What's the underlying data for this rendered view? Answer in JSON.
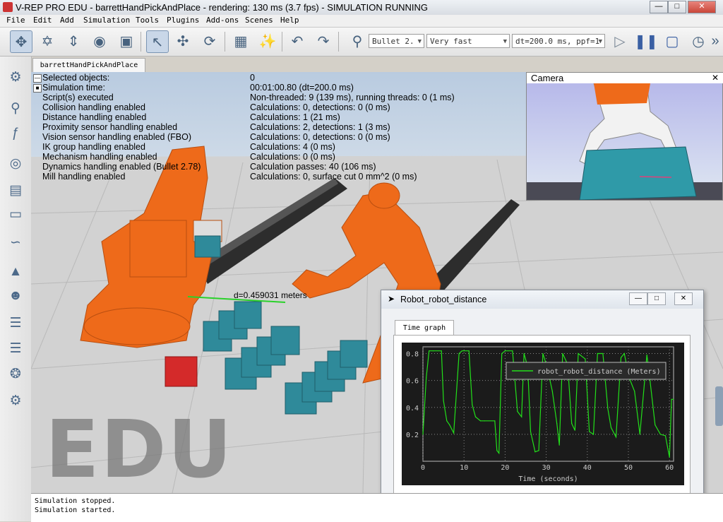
{
  "window": {
    "title": "V-REP PRO EDU - barrettHandPickAndPlace - rendering: 130 ms (3.7 fps) - SIMULATION RUNNING",
    "min": "—",
    "max": "□",
    "close": "✕"
  },
  "menu": [
    "File",
    "Edit",
    "Add",
    "Simulation",
    "Tools",
    "Plugins",
    "Add-ons",
    "Scenes",
    "Help"
  ],
  "toolbar": {
    "engine": "Bullet 2.",
    "speed": "Very fast",
    "timestep": "dt=200.0 ms, ppf=1"
  },
  "scene_tab": "barrettHandPickAndPlace",
  "info": {
    "labels": [
      "Selected objects:",
      "Simulation time:",
      "Script(s) executed",
      "Collision handling enabled",
      "Distance handling enabled",
      "Proximity sensor handling enabled",
      "Vision sensor handling enabled (FBO)",
      "IK group handling enabled",
      "Mechanism handling enabled",
      "Dynamics handling enabled (Bullet 2.78)",
      "Mill handling enabled"
    ],
    "values": [
      "0",
      "00:01:00.80 (dt=200.0 ms)",
      "Non-threaded: 9 (139 ms), running threads: 0 (1 ms)",
      "Calculations: 0, detections: 0 (0 ms)",
      "Calculations: 1 (21 ms)",
      "Calculations: 2, detections: 1 (3 ms)",
      "Calculations: 0, detections: 0 (0 ms)",
      "Calculations: 4 (0 ms)",
      "Calculations: 0 (0 ms)",
      "Calculation passes: 40 (106 ms)",
      "Calculations: 0, surface cut 0 mm^2 (0 ms)"
    ]
  },
  "distance_label": "d=0.459031 meters",
  "watermark": "EDU",
  "camera": {
    "title": "Camera",
    "close": "✕"
  },
  "graph": {
    "window_title": "Robot_robot_distance",
    "tab": "Time graph",
    "min": "—",
    "max": "□",
    "close": "✕"
  },
  "console": [
    "Simulation stopped.",
    "Simulation started."
  ],
  "colors": {
    "robot_orange": "#ee6a1a",
    "box_teal": "#2f8a9a",
    "box_red": "#d42a2a",
    "graph_line": "#22e01a",
    "graph_bg": "#1b1b1b"
  },
  "chart_data": {
    "type": "line",
    "title": "",
    "xlabel": "Time (seconds)",
    "ylabel": "",
    "xlim": [
      0,
      61
    ],
    "ylim": [
      0,
      0.85
    ],
    "xticks": [
      0,
      10,
      20,
      30,
      40,
      50,
      60
    ],
    "yticks": [
      0.2,
      0.4,
      0.6,
      0.8
    ],
    "grid": true,
    "legend": "top-right",
    "series": [
      {
        "name": "robot_robot_distance (Meters)",
        "x": [
          0,
          0.8,
          1.5,
          2.5,
          4.5,
          5,
          5.8,
          6.5,
          7.5,
          8.8,
          9.5,
          11.2,
          12,
          12.8,
          14,
          15,
          17.5,
          18,
          18.5,
          19.2,
          20,
          21.8,
          23,
          24,
          24.6,
          25.5,
          26.2,
          27.3,
          28.2,
          29.2,
          30.2,
          31.5,
          32.6,
          33.2,
          34,
          35.2,
          36.2,
          37,
          37.8,
          39.5,
          40.5,
          41.5,
          42.5,
          43.8,
          45,
          45.8,
          47,
          48.2,
          49,
          50.2,
          51.5,
          52.8,
          54.5,
          55.2,
          56.5,
          57.8,
          59,
          60,
          60.5,
          61
        ],
        "y": [
          0.2,
          0.62,
          0.82,
          0.82,
          0.82,
          0.45,
          0.3,
          0.27,
          0.21,
          0.8,
          0.82,
          0.82,
          0.42,
          0.33,
          0.3,
          0.3,
          0.3,
          0.08,
          0.06,
          0.8,
          0.82,
          0.82,
          0.37,
          0.33,
          0.8,
          0.7,
          0.22,
          0.07,
          0.08,
          0.8,
          0.7,
          0.52,
          0.28,
          0.12,
          0.8,
          0.72,
          0.28,
          0.23,
          0.8,
          0.76,
          0.22,
          0.2,
          0.8,
          0.8,
          0.39,
          0.25,
          0.18,
          0.77,
          0.8,
          0.62,
          0.52,
          0.2,
          0.79,
          0.62,
          0.27,
          0.2,
          0.19,
          0.03,
          0.46,
          0.46
        ]
      }
    ]
  }
}
